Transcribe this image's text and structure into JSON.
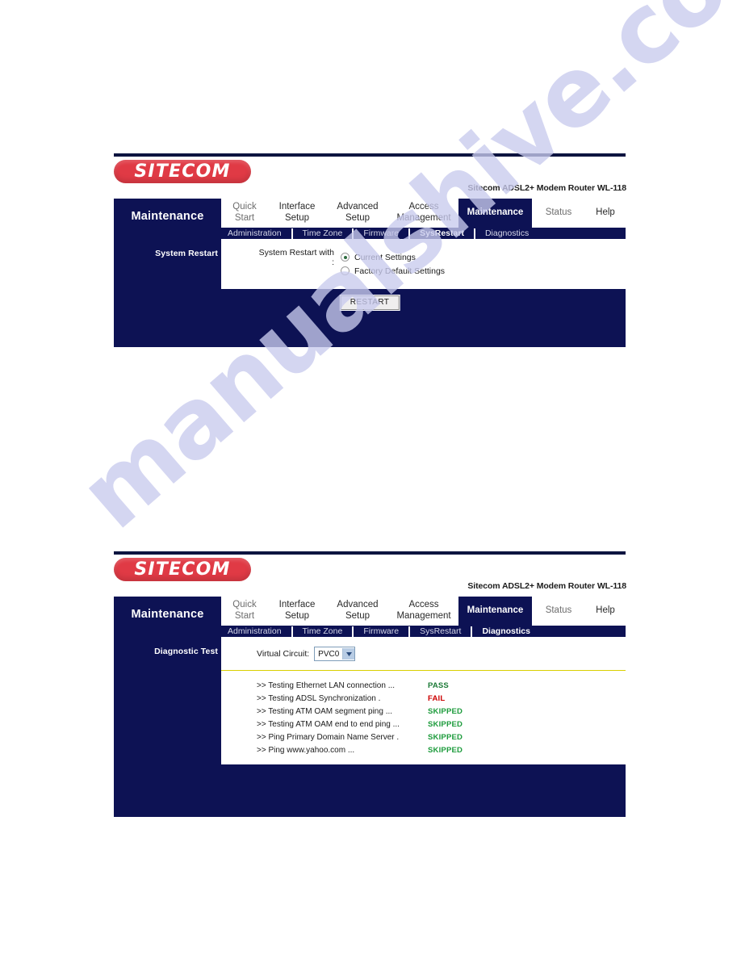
{
  "watermark": {
    "text": "manualshive.com"
  },
  "brand": {
    "logo_text": "SITECOM",
    "model_text": "Sitecom ADSL2+ Modem Router WL-118"
  },
  "panels": [
    {
      "section_title": "Maintenance",
      "main_tabs": [
        {
          "label": "Quick\nStart",
          "active": false
        },
        {
          "label": "Interface\nSetup",
          "active": false
        },
        {
          "label": "Advanced\nSetup",
          "active": false
        },
        {
          "label": "Access\nManagement",
          "active": false
        },
        {
          "label": "Maintenance",
          "active": true
        },
        {
          "label": "Status",
          "active": false
        },
        {
          "label": "Help",
          "active": false
        }
      ],
      "sub_tabs": [
        {
          "label": "Administration",
          "active": false
        },
        {
          "label": "Time Zone",
          "active": false
        },
        {
          "label": "Firmware",
          "active": false
        },
        {
          "label": "SysRestart",
          "active": true
        },
        {
          "label": "Diagnostics",
          "active": false
        }
      ],
      "row_label": "System Restart",
      "form": {
        "field_label": "System Restart with :",
        "options": [
          {
            "label": "Current Settings",
            "selected": true
          },
          {
            "label": "Factory Default Settings",
            "selected": false
          }
        ]
      },
      "button_label": "RESTART"
    },
    {
      "section_title": "Maintenance",
      "main_tabs": [
        {
          "label": "Quick\nStart",
          "active": false
        },
        {
          "label": "Interface\nSetup",
          "active": false
        },
        {
          "label": "Advanced\nSetup",
          "active": false
        },
        {
          "label": "Access\nManagement",
          "active": false
        },
        {
          "label": "Maintenance",
          "active": true
        },
        {
          "label": "Status",
          "active": false
        },
        {
          "label": "Help",
          "active": false
        }
      ],
      "sub_tabs": [
        {
          "label": "Administration",
          "active": false
        },
        {
          "label": "Time Zone",
          "active": false
        },
        {
          "label": "Firmware",
          "active": false
        },
        {
          "label": "SysRestart",
          "active": false
        },
        {
          "label": "Diagnostics",
          "active": true
        }
      ],
      "row_label": "Diagnostic Test",
      "virtual_circuit": {
        "label": "Virtual Circuit:",
        "value": "PVC0",
        "arrow_icon": "chevron-down-icon"
      },
      "tests": [
        {
          "name": ">> Testing Ethernet LAN connection ...",
          "result": "PASS",
          "result_state": "pass"
        },
        {
          "name": ">> Testing ADSL Synchronization .",
          "result": "FAIL",
          "result_state": "fail"
        },
        {
          "name": ">> Testing ATM OAM segment ping ...",
          "result": "SKIPPED",
          "result_state": "skipped"
        },
        {
          "name": ">> Testing ATM OAM end to end ping ...",
          "result": "SKIPPED",
          "result_state": "skipped"
        },
        {
          "name": ">> Ping Primary Domain Name Server .",
          "result": "SKIPPED",
          "result_state": "skipped"
        },
        {
          "name": ">> Ping www.yahoo.com ...",
          "result": "SKIPPED",
          "result_state": "skipped"
        }
      ]
    }
  ],
  "colors": {
    "navy": "#0d1254",
    "logo_red": "#e03a45",
    "pass_green": "#1c7a37",
    "fail_red": "#cc0000",
    "skipped_green": "#1d9b3c",
    "divider_yellow": "#d9d000",
    "watermark": "#c9cbee"
  }
}
